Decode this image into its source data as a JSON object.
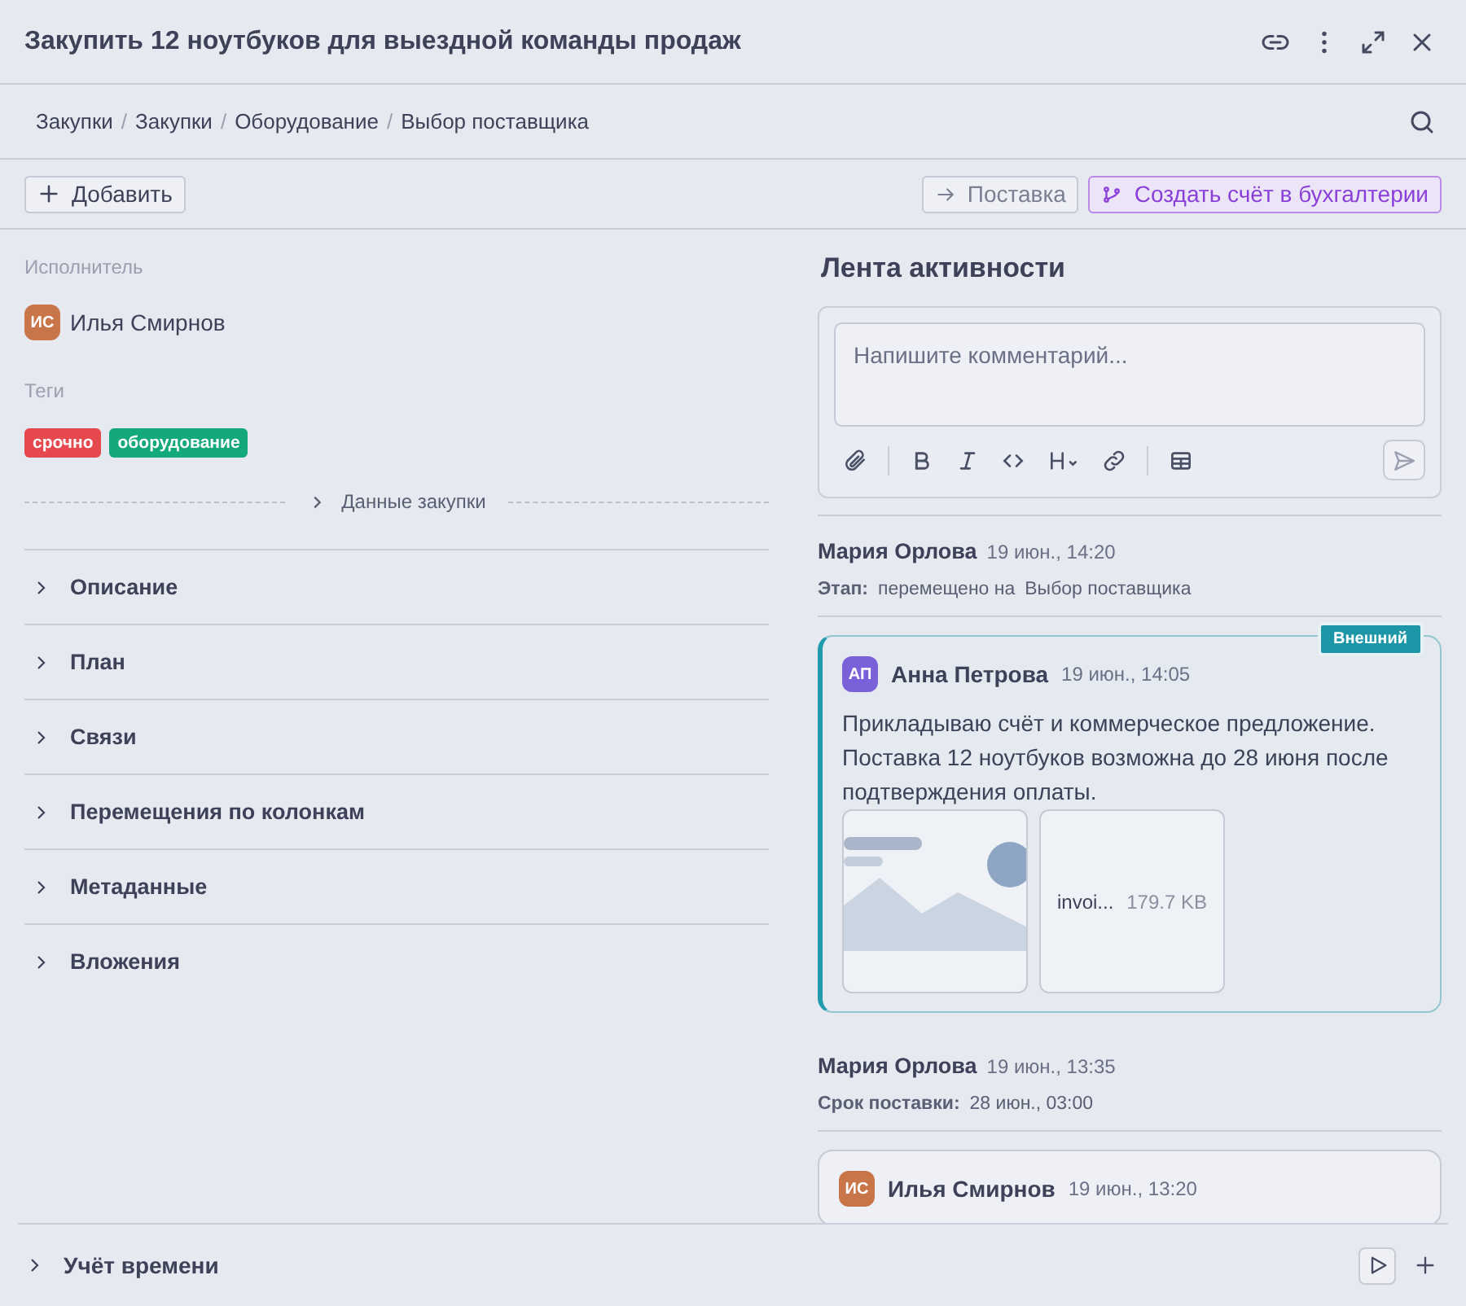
{
  "window": {
    "title": "Закупить 12 ноутбуков для выездной команды продаж"
  },
  "breadcrumbs": {
    "separator": "/",
    "items": [
      "Закупки",
      "Закупки",
      "Оборудование",
      "Выбор поставщика"
    ]
  },
  "toolbar": {
    "add_button": "Добавить",
    "actions": [
      {
        "kind": "move",
        "label": "Поставка"
      },
      {
        "kind": "accent",
        "label": "Создать счёт в бухгалтерии"
      }
    ]
  },
  "assignee": {
    "label": "Исполнитель",
    "initials": "ИС",
    "name": "Илья Смирнов",
    "color": "#c8754a"
  },
  "tags": {
    "label": "Теги",
    "items": [
      {
        "label": "срочно",
        "color": "#e5484d"
      },
      {
        "label": "оборудование",
        "color": "#14a97b"
      }
    ]
  },
  "purchase_data": {
    "label": "Данные закупки",
    "expanded": false
  },
  "sections": [
    {
      "label": "Описание",
      "expanded": false
    },
    {
      "label": "План",
      "expanded": false
    },
    {
      "label": "Связи",
      "expanded": false
    },
    {
      "label": "Перемещения по колонкам",
      "expanded": false
    },
    {
      "label": "Метаданные",
      "expanded": false
    },
    {
      "label": "Вложения",
      "expanded": false
    }
  ],
  "activity": {
    "title": "Лента активности",
    "comment_placeholder": "Напишите комментарий...",
    "items": [
      {
        "kind": "event",
        "author": "Мария Орлова",
        "time": "19 июн., 14:20",
        "field": "Этап:",
        "text": "перемещено на",
        "value": "Выбор поставщика"
      },
      {
        "kind": "comment",
        "author": "Анна Петрова",
        "initials": "АП",
        "color": "#7b61d9",
        "time": "19 июн., 14:05",
        "external": true,
        "badge": "Внешний",
        "text": "Прикладываю счёт и коммерческое предложение. Поставка 12 ноутбуков возможна до 28 июня после подтверждения оплаты.",
        "attachments": [
          {
            "kind": "image"
          },
          {
            "kind": "file",
            "name": "invoi...",
            "size": "179.7 KB"
          }
        ]
      },
      {
        "kind": "event",
        "author": "Мария Орлова",
        "time": "19 июн., 13:35",
        "field": "Срок поставки:",
        "value": "28 июн., 03:00"
      },
      {
        "kind": "comment",
        "author": "Илья Смирнов",
        "initials": "ИС",
        "color": "#c8754a",
        "time": "19 июн., 13:20",
        "external": false
      }
    ]
  },
  "time_tracking": {
    "label": "Учёт времени",
    "expanded": false
  }
}
